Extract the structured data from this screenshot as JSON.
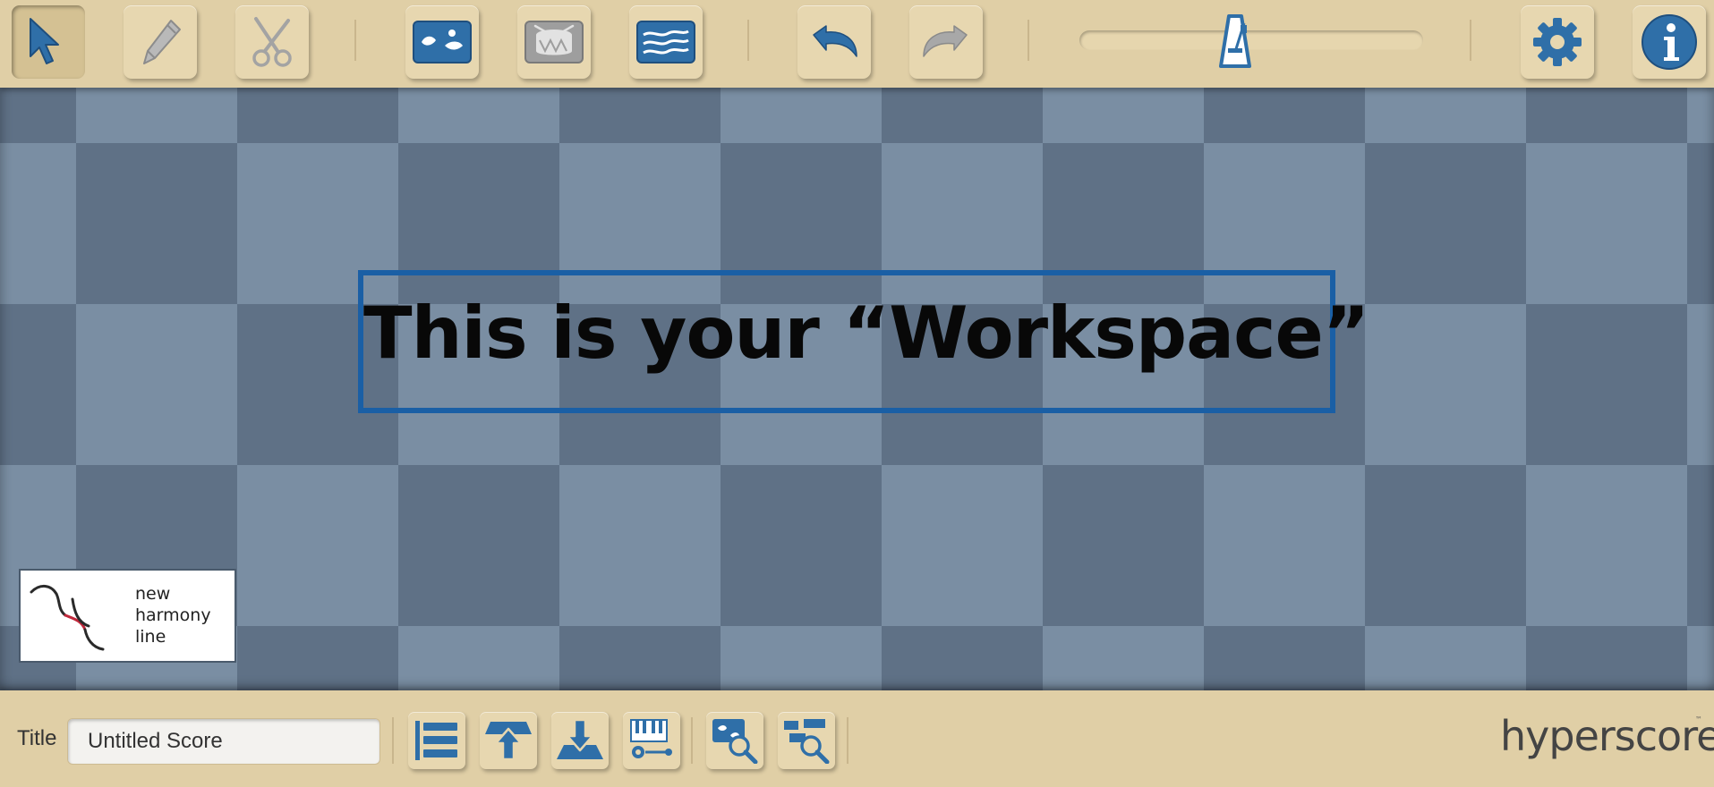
{
  "toolbar": {
    "tools": [
      {
        "name": "select-tool",
        "icon": "pointer-arrow-icon",
        "active": true
      },
      {
        "name": "pencil-tool",
        "icon": "pencil-icon",
        "active": false
      },
      {
        "name": "scissors-tool",
        "icon": "scissors-icon",
        "active": false
      }
    ],
    "windows": [
      {
        "name": "melody-window",
        "icon": "melody-window-icon"
      },
      {
        "name": "percussion-window",
        "icon": "drum-window-icon"
      },
      {
        "name": "sketch-window",
        "icon": "sketch-lines-window-icon"
      }
    ],
    "history": [
      {
        "name": "undo",
        "icon": "undo-arrow-icon"
      },
      {
        "name": "redo",
        "icon": "redo-arrow-icon"
      }
    ],
    "tempo_slider": {
      "icon": "metronome-icon",
      "value": 0.5
    },
    "settings_icon": "gear-icon",
    "info_icon": "info-icon"
  },
  "workspace": {
    "caption": "This is your “Workspace”"
  },
  "logo": {
    "lines": [
      "new",
      "harmony",
      "line"
    ],
    "accent_color": "#c0283b"
  },
  "bottom_bar": {
    "title_label": "Title",
    "title_value": "Untitled Score",
    "buttons": [
      {
        "name": "list-view",
        "icon": "list-icon"
      },
      {
        "name": "export",
        "icon": "export-arrow-icon"
      },
      {
        "name": "import",
        "icon": "import-arrow-icon"
      },
      {
        "name": "keyboard",
        "icon": "piano-keyboard-icon"
      },
      {
        "name": "zoom-window",
        "icon": "zoom-window-icon"
      },
      {
        "name": "zoom-blocks",
        "icon": "zoom-blocks-icon"
      }
    ],
    "brand": "hyperscore",
    "brand_tm": "™"
  },
  "colors": {
    "toolbar_bg": "#e0cfa6",
    "icon_blue": "#2f6fa8",
    "icon_gray": "#9a9a9a",
    "checker_light": "#7a8ea3",
    "checker_dark": "#5f7186",
    "caption_border": "#1a5fa5"
  }
}
